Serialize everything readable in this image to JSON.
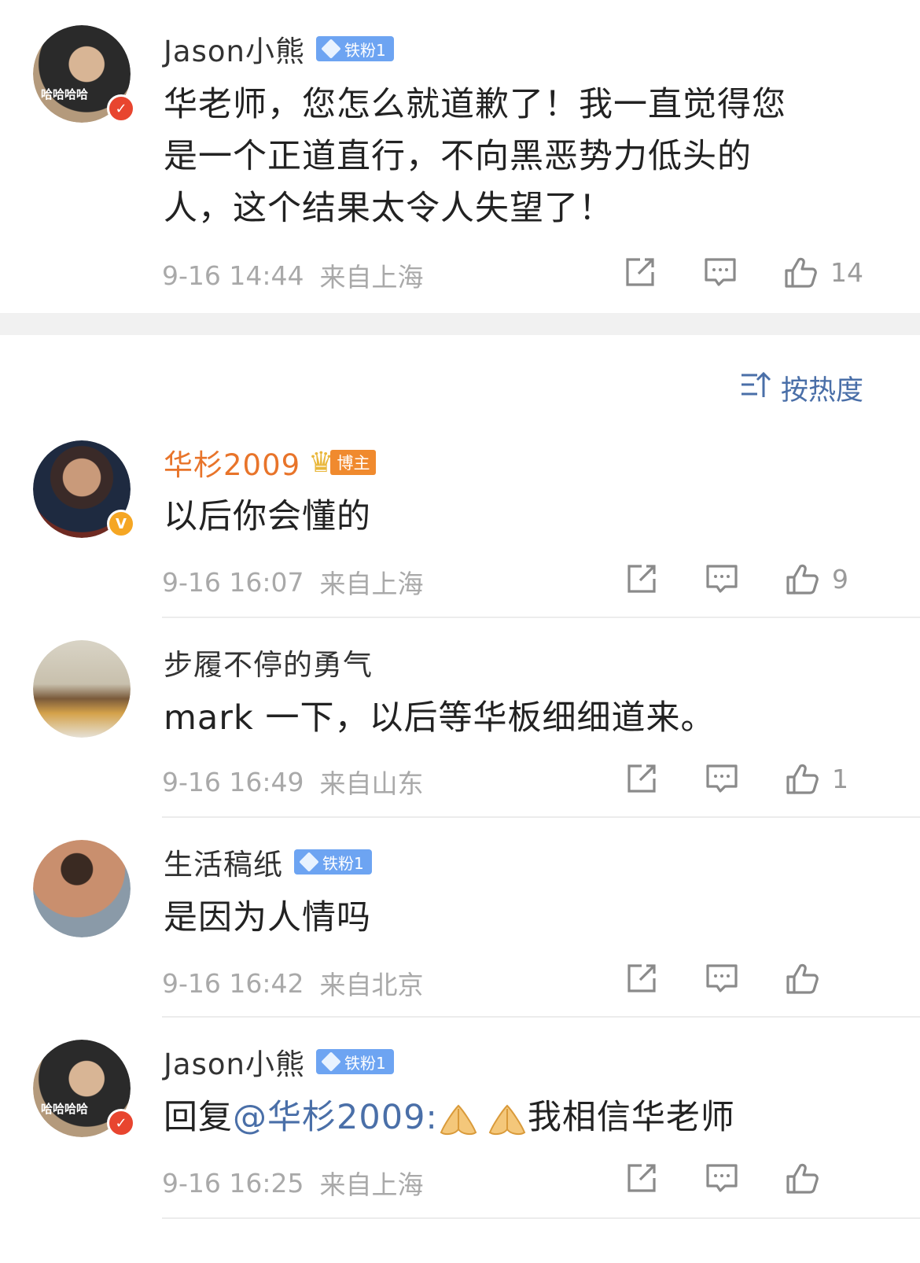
{
  "main_comment": {
    "user": "Jason小熊",
    "badge": "铁粉1",
    "text_lines": [
      "华老师，您怎么就道歉了！我一直觉得您",
      "是一个正道直行，不向黑恶势力低头的",
      "人，这个结果太令人失望了！"
    ],
    "time": "9-16 14:44",
    "location": "来自上海",
    "likes": "14",
    "avatar_label": "哈哈哈哈"
  },
  "sort": {
    "label": "按热度",
    "icon": "sort-icon"
  },
  "replies": [
    {
      "user": "华杉2009",
      "badge": "博主",
      "text": "以后你会懂的",
      "time": "9-16 16:07",
      "location": "来自上海",
      "likes": "9"
    },
    {
      "user": "步履不停的勇气",
      "text": "mark 一下，以后等华板细细道来。",
      "time": "9-16 16:49",
      "location": "来自山东",
      "likes": "1"
    },
    {
      "user": "生活稿纸",
      "badge": "铁粉1",
      "text": "是因为人情吗",
      "time": "9-16 16:42",
      "location": "来自北京",
      "likes": ""
    },
    {
      "user": "Jason小熊",
      "badge": "铁粉1",
      "text_prefix": "回复",
      "mention": "@华杉2009:",
      "text_suffix": "我相信华老师",
      "time": "9-16 16:25",
      "location": "来自上海",
      "likes": "",
      "avatar_label": "哈哈哈哈"
    }
  ],
  "colors": {
    "link": "#4a6fa8",
    "host_name": "#e8742a",
    "fan_badge": "#6da4f2",
    "meta": "#a9a9a9"
  }
}
